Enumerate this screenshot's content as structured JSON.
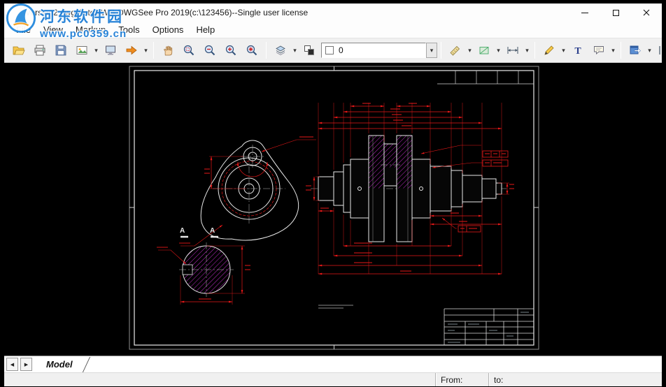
{
  "window": {
    "title": "Version2.dwg AutoDWG DWGSee Pro 2019(c:\\123456)--Single user license"
  },
  "menu": {
    "items": [
      {
        "label": "File"
      },
      {
        "label": "View"
      },
      {
        "label": "Markup"
      },
      {
        "label": "Tools"
      },
      {
        "label": "Options"
      },
      {
        "label": "Help"
      }
    ]
  },
  "toolbar": {
    "layer_combo": {
      "value": "0"
    },
    "text_tool_glyph": "T",
    "dropdown_glyph": "▾"
  },
  "icons": {
    "open": "folder-open",
    "print": "printer",
    "save": "floppy-disk",
    "convert": "image-convert",
    "capture": "screen-capture",
    "export": "orange-arrow-right",
    "pan": "hand",
    "zoom_window": "magnifier-with-rect",
    "zoom_out": "magnifier-minus",
    "zoom_in": "magnifier-plus",
    "zoom_extents": "magnifier-star",
    "layers": "stacked-layers",
    "background": "overlapping-squares",
    "measure_distance": "diagonal-ruler",
    "measure_area": "rect-with-diagonal",
    "measure_length": "double-headed-arrow",
    "markup_pen": "pencil",
    "markup_text": "letter-T",
    "markup_cloud": "speech-balloon",
    "publish": "blue-window-arrow",
    "polyline": "vertical-lines",
    "dropdown": "small-down-triangle",
    "minimize": "horizontal-bar",
    "maximize": "square-outline",
    "close": "x-cross"
  },
  "watermark": {
    "site_name": "河东软件园",
    "site_url": "www.pc0359.cn"
  },
  "tabs": {
    "nav_prev": "◀",
    "nav_next": "▶",
    "items": [
      {
        "label": "Model"
      }
    ]
  },
  "statusbar": {
    "from_label": "From:",
    "to_label": "to:"
  },
  "drawing": {
    "section_mark": "A"
  }
}
